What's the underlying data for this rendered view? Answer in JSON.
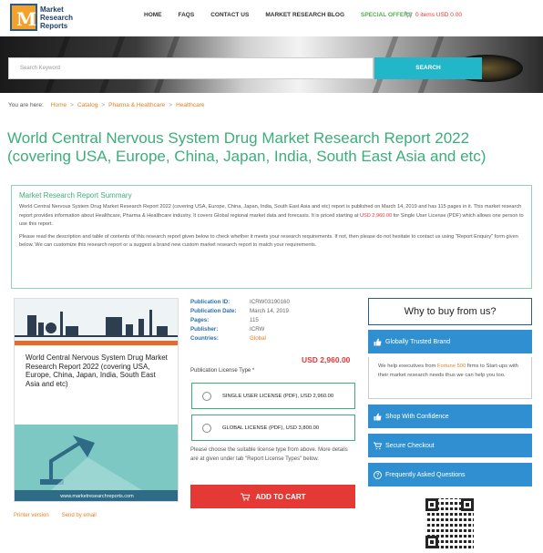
{
  "header": {
    "logo_lines": [
      "Market",
      "Research",
      "Reports"
    ],
    "logo_mark": "M",
    "nav": [
      "HOME",
      "FAQS",
      "CONTACT US",
      "MARKET RESEARCH BLOG",
      "SPECIAL OFFERS"
    ],
    "cart": "0 items USD 0.00"
  },
  "search": {
    "placeholder": "Search Keyword",
    "button": "SEARCH"
  },
  "breadcrumb": {
    "prefix": "You are here:",
    "items": [
      "Home",
      "Catalog",
      "Pharma & Healthcare",
      "Healthcare"
    ]
  },
  "title": "World Central Nervous System Drug Market Research Report 2022 (covering USA, Europe, China, Japan, India, South East Asia and etc)",
  "summary": {
    "heading": "Market Research Report Summary",
    "p1_before": "World Central Nervous System Drug Market Research Report 2022 (covering USA, Europe, China, Japan, India, South East Asia and etc) report is published on March 14, 2019 and has 115 pages in it. This market research report provides information about Healthcare, Pharma & Healthcare industry. It covers Global regional market data and forecasts. It is priced starting at ",
    "p1_price": "USD 2,960.00",
    "p1_after": " for Single User License (PDF) which allows one person to use this report.",
    "p2": "Please read the description and table of contents of this research report given below to check whether it meets your research requirements. If not, then please do not hesitate to contact us using \"Report Enquiry\" form given below. We can customize this research report or a suggest a brand new custom market research report to match your requirements."
  },
  "report_card": {
    "caption": "World Central Nervous System Drug Market Research Report 2022 (covering USA, Europe, China, Japan, India, South East Asia and etc)",
    "url": "www.marketresearchreports.com"
  },
  "links": {
    "printer": "Printer version",
    "email": "Send by email"
  },
  "meta": [
    {
      "key": "Publication ID:",
      "value": "ICRW03190160"
    },
    {
      "key": "Publication Date:",
      "value": "March 14, 2019"
    },
    {
      "key": "Pages:",
      "value": "115"
    },
    {
      "key": "Publisher:",
      "value": "ICRW"
    },
    {
      "key": "Countries:",
      "value": "Global"
    }
  ],
  "price": "USD 2,960.00",
  "license": {
    "label": "Publication License Type *",
    "options": [
      "SINGLE USER LICENSE (PDF), USD 2,960.00",
      "GLOBAL LICENSE (PDF), USD 3,800.00"
    ],
    "note": "Please choose the suitable license type from above. More details are at given under tab \"Report License Types\" below."
  },
  "add_to_cart": "ADD TO CART",
  "sidebar": {
    "why": "Why to buy from us?",
    "trusted": "Globally Trusted Brand",
    "trusted_before": "We help executives from ",
    "trusted_hl": "Fortune 500",
    "trusted_after": " firms to Start-ups with their market research needs thus we can help you too.",
    "shop": "Shop With Confidence",
    "secure": "Secure Checkout",
    "faq": "Frequently Asked Questions"
  },
  "colors": {
    "accent_green": "#3dae7a",
    "search_button": "#21b7c8",
    "cart_red": "#e53935",
    "sidebar_blue": "#2f8fd1",
    "link_orange": "#e67e22"
  }
}
